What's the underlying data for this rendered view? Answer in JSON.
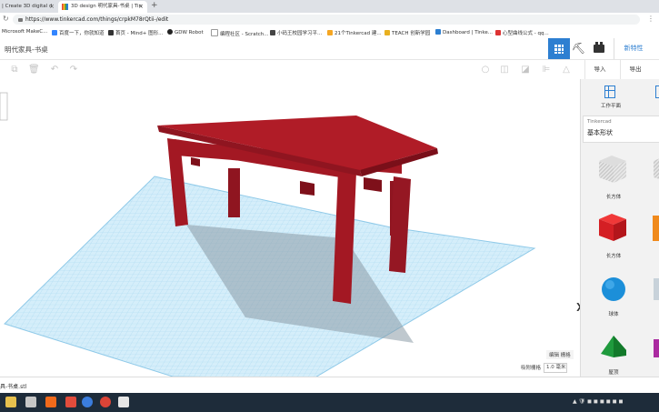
{
  "browser": {
    "tabs": [
      {
        "label": "| Create 3D digital d"
      },
      {
        "label": "3D design 明代家具-书桌 | Tin"
      }
    ],
    "new_tab_symbol": "+",
    "url": "https://www.tinkercad.com/things/crpkM78rQtii-/edit",
    "bookmarks": [
      {
        "label": "Microsoft MakeC...",
        "color": "#0078d4"
      },
      {
        "label": "百度一下，你就知道",
        "color": "#3385ff"
      },
      {
        "label": "首页 - Mind+ 图形...",
        "color": "#333333"
      },
      {
        "label": "GDW Robot",
        "color": "#222222"
      },
      {
        "label": "编程社区 - Scratch...",
        "color": "#e39b2c"
      },
      {
        "label": "小码王校园学习平...",
        "color": "#444444"
      },
      {
        "label": "21个Tinkercad 建...",
        "color": "#f5a623"
      },
      {
        "label": "TEACH 创新学园",
        "color": "#e8b020"
      },
      {
        "label": "Dashboard | Tinke...",
        "color": "#2d7fd1"
      },
      {
        "label": "心型曲线公式 - qq...",
        "color": "#d33"
      }
    ]
  },
  "app": {
    "design_title": "明代家具-书桌",
    "new_button": "新特性",
    "import_button": "导入",
    "export_button": "导出",
    "accent_color": "#2d7fd1"
  },
  "viewport": {
    "snap_label": "编辑 栅格",
    "snap_grid_label": "吸附栅格",
    "snap_grid_value": "1.0 毫米",
    "model_color": "#a31823",
    "grid_color": "#8ec9e8"
  },
  "panel": {
    "workplane_label": "工作平面",
    "library_brand": "Tinkercad",
    "library_category": "基本形状",
    "shapes": [
      {
        "label": "长方体",
        "icon": "striped-box-icon"
      },
      {
        "label": "长方体",
        "icon": "red-box-icon"
      },
      {
        "label": "球体",
        "icon": "blue-sphere-icon"
      },
      {
        "label": "屋顶",
        "icon": "green-roof-icon"
      }
    ]
  },
  "downloads": {
    "file": "具-书桌.stl"
  }
}
